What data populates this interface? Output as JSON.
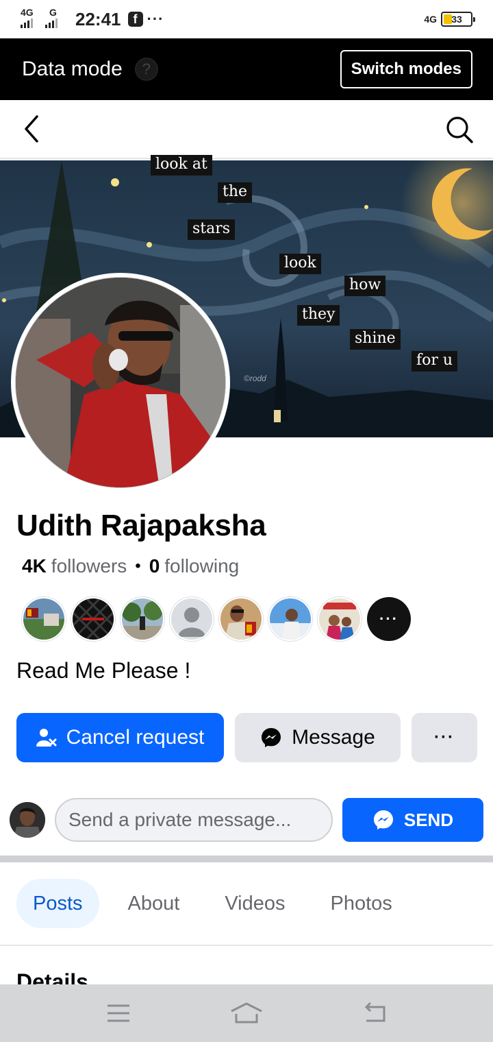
{
  "status_bar": {
    "signal1_label": "4G",
    "signal2_label": "G",
    "time": "22:41",
    "app_icon_label": "f",
    "more_label": "···",
    "net_label": "4G",
    "battery_percent": "33",
    "battery_level": 0.33,
    "battery_color": "#f2c200"
  },
  "data_mode_bar": {
    "title": "Data mode",
    "help_label": "?",
    "switch_label": "Switch modes"
  },
  "nav": {
    "back_icon": "chevron-left-icon",
    "search_icon": "search-icon"
  },
  "cover": {
    "words": [
      "look at",
      "the",
      "stars",
      "look",
      "how",
      "they",
      "shine",
      "for u"
    ],
    "watermark": "©rodd"
  },
  "profile": {
    "name": "Udith Rajapaksha",
    "followers_count": "4K",
    "followers_label": "followers",
    "separator": "•",
    "following_count": "0",
    "following_label": "following",
    "more_friends_label": "···",
    "bio": "Read Me Please !"
  },
  "actions": {
    "cancel_request_label": "Cancel request",
    "message_label": "Message",
    "more_label": "···"
  },
  "private_message": {
    "placeholder": "Send a private message...",
    "send_label": "SEND"
  },
  "tabs": [
    {
      "label": "Posts",
      "active": true
    },
    {
      "label": "About",
      "active": false
    },
    {
      "label": "Videos",
      "active": false
    },
    {
      "label": "Photos",
      "active": false
    }
  ],
  "section_heading": "Details",
  "colors": {
    "brand_blue": "#0866ff",
    "active_tab_bg": "#ebf5ff",
    "active_tab_text": "#0a58ca",
    "button_gray": "#e4e6eb",
    "secondary_text": "#65676b"
  },
  "system_nav": {
    "menu_icon": "menu-icon",
    "home_icon": "home-icon",
    "back_icon": "back-arrow-icon"
  }
}
